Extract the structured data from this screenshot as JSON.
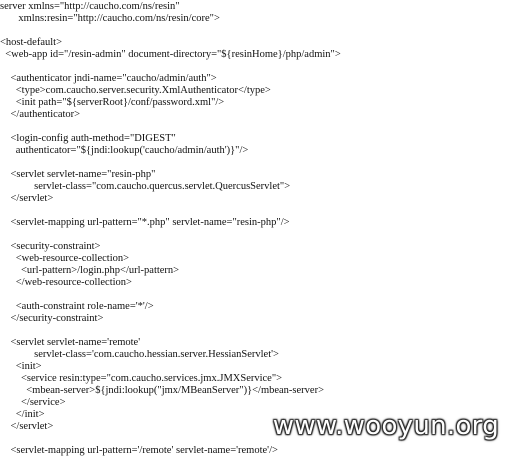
{
  "code": {
    "lines": [
      "server xmlns=\"http://caucho.com/ns/resin\"",
      "       xmlns:resin=\"http://caucho.com/ns/resin/core\">",
      "",
      "<host-default>",
      "  <web-app id=\"/resin-admin\" document-directory=\"${resinHome}/php/admin\">",
      "",
      "    <authenticator jndi-name=\"caucho/admin/auth\">",
      "      <type>com.caucho.server.security.XmlAuthenticator</type>",
      "      <init path=\"${serverRoot}/conf/password.xml\"/>",
      "    </authenticator>",
      "",
      "    <login-config auth-method=\"DIGEST\"",
      "      authenticator=\"${jndi:lookup('caucho/admin/auth')}\"/>",
      "",
      "    <servlet servlet-name=\"resin-php\"",
      "             servlet-class=\"com.caucho.quercus.servlet.QuercusServlet\">",
      "    </servlet>",
      "",
      "    <servlet-mapping url-pattern=\"*.php\" servlet-name=\"resin-php\"/>",
      "",
      "    <security-constraint>",
      "      <web-resource-collection>",
      "        <url-pattern>/login.php</url-pattern>",
      "      </web-resource-collection>",
      "",
      "      <auth-constraint role-name='*'/>",
      "    </security-constraint>",
      "",
      "    <servlet servlet-name='remote'",
      "             servlet-class='com.caucho.hessian.server.HessianServlet'>",
      "      <init>",
      "        <service resin:type=\"com.caucho.services.jmx.JMXService\">",
      "          <mbean-server>${jndi:lookup(\"jmx/MBeanServer\")}</mbean-server>",
      "        </service>",
      "      </init>",
      "    </servlet>",
      "",
      "    <servlet-mapping url-pattern='/remote' servlet-name='remote'/>"
    ]
  },
  "watermark": {
    "text": "www.wooyun.org"
  }
}
